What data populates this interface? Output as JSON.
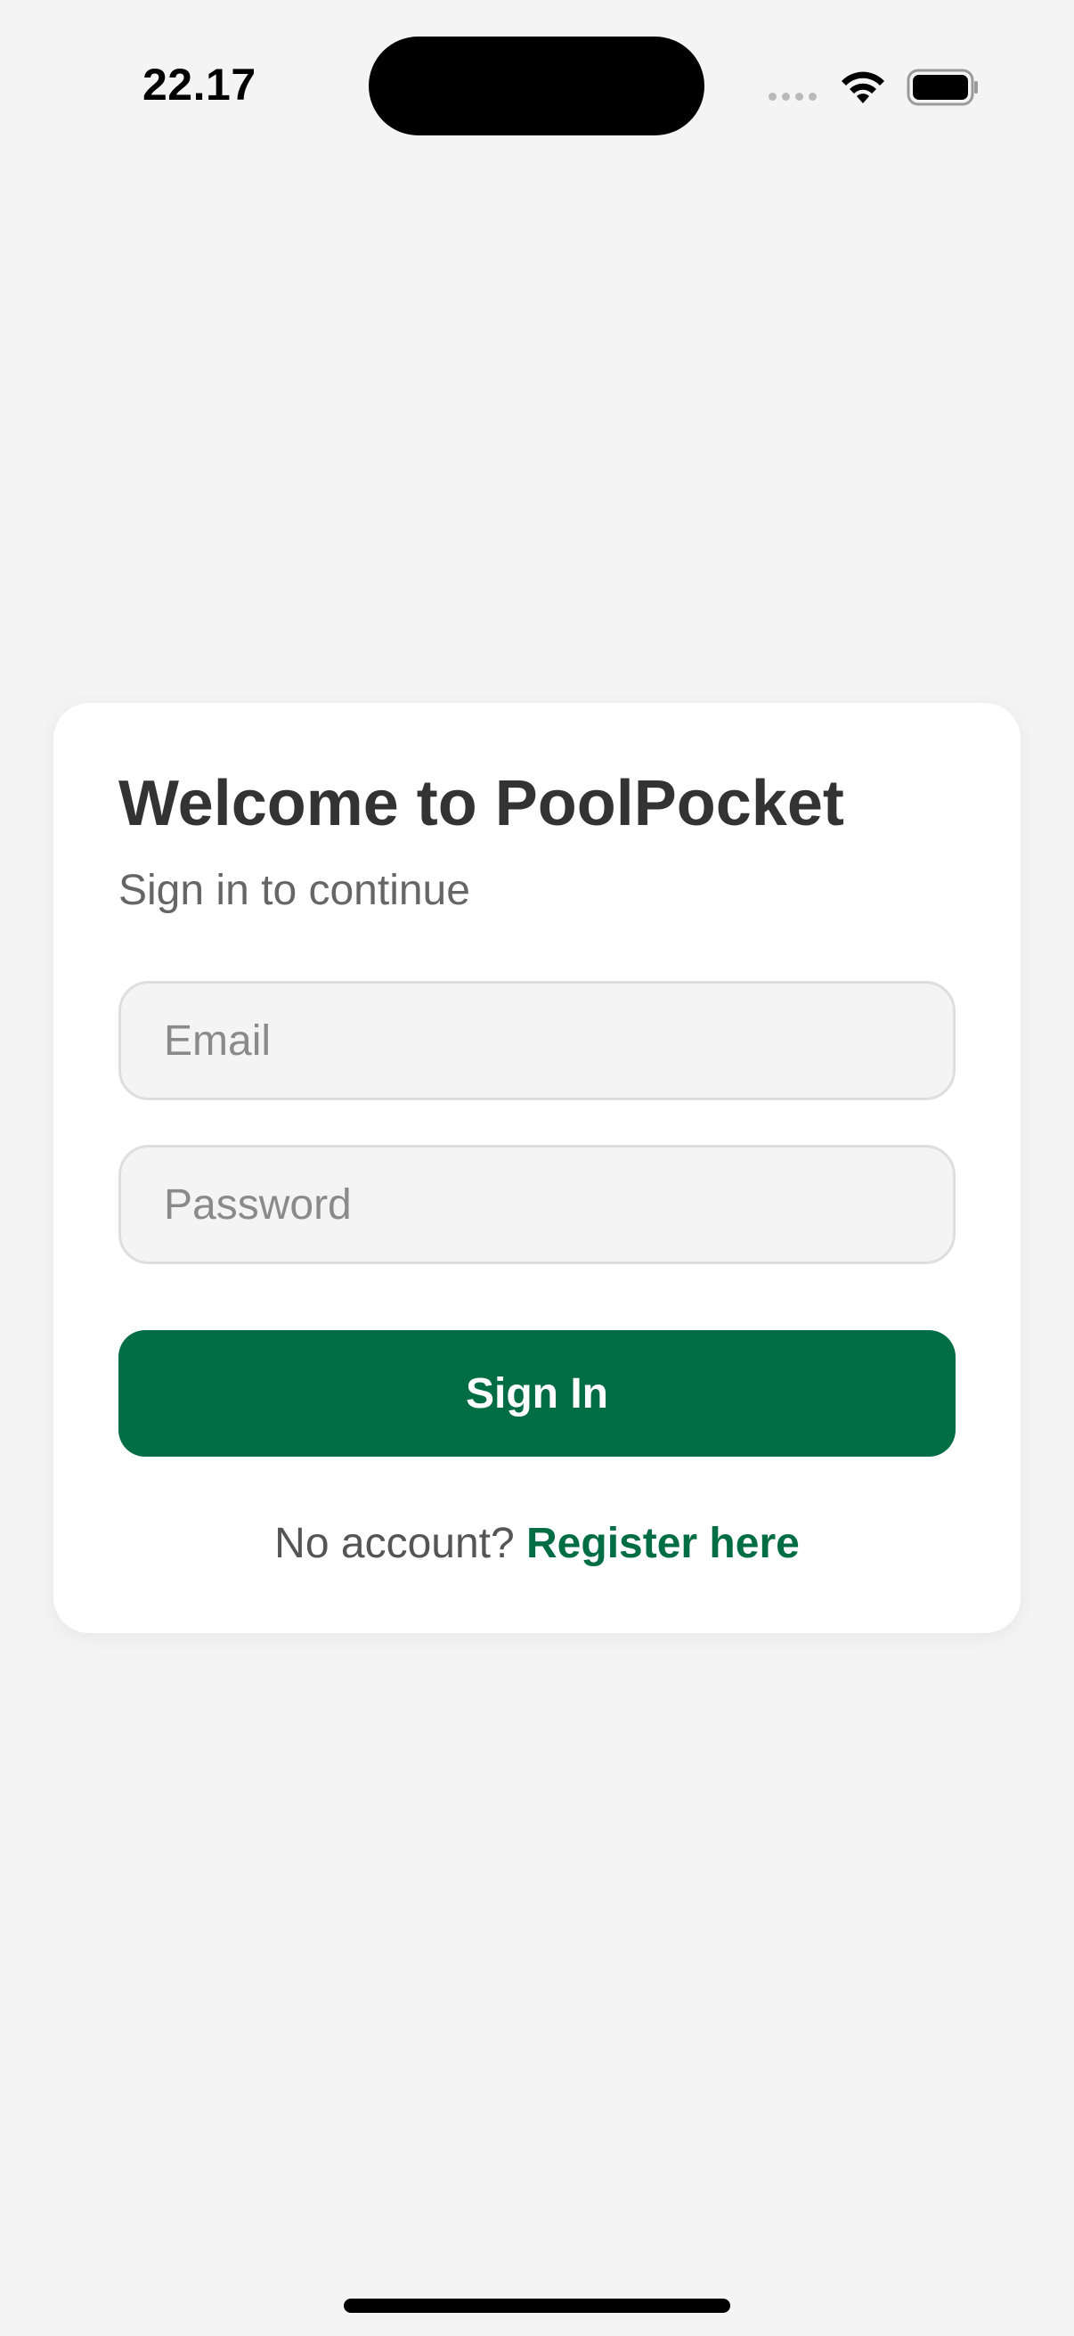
{
  "status_bar": {
    "time": "22.17",
    "signal_icon": "signal-dots-icon",
    "wifi_icon": "wifi-icon",
    "battery_icon": "battery-icon"
  },
  "login": {
    "title": "Welcome to PoolPocket",
    "subtitle": "Sign in to continue",
    "email_placeholder": "Email",
    "email_value": "",
    "password_placeholder": "Password",
    "password_value": "",
    "sign_in_label": "Sign In",
    "register_prompt": "No account?",
    "register_link": "Register here"
  },
  "colors": {
    "background": "#f4f4f4",
    "card": "#ffffff",
    "accent": "#006d44",
    "title": "#333333",
    "subtitle": "#666666",
    "placeholder": "#8a8a8a"
  }
}
